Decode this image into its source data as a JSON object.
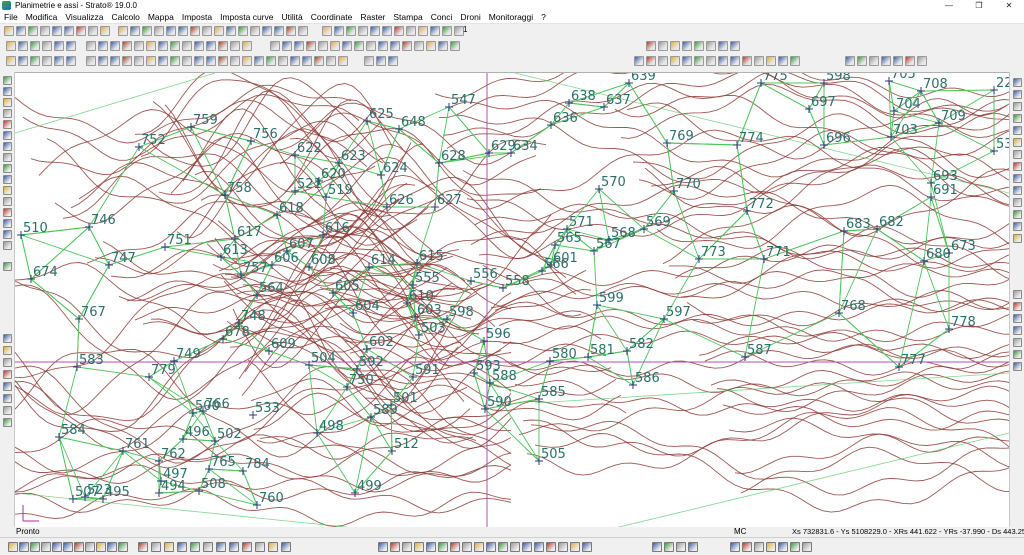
{
  "window": {
    "title": "Planimetrie e assi - Strato® 19.0.0",
    "controls": {
      "minimize": "—",
      "maximize": "❐",
      "close": "✕"
    }
  },
  "menu": [
    "File",
    "Modifica",
    "Visualizza",
    "Calcolo",
    "Mappa",
    "Imposta",
    "Imposta curve",
    "Utilità",
    "Coordinate",
    "Raster",
    "Stampa",
    "Conci",
    "Droni",
    "Monitoraggi",
    "?"
  ],
  "toolbar": {
    "zoom_digit": "1",
    "icon_colors": {
      "primary": "#3a5fa8",
      "green": "#3c9a3c",
      "red": "#c0392b",
      "yellow": "#e0b030",
      "neutral": "#9a9a9a",
      "magenta": "#b0308f"
    }
  },
  "map": {
    "background": "#ffffff",
    "contour_color": "#8c3a34",
    "triangulation_color": "#4bc45a",
    "axis_color": "#b84db8",
    "label_color": "#2b6f6a",
    "marker_color": "#2b3a7a",
    "point_labels": [
      "639",
      "775",
      "598",
      "705",
      "708",
      "22",
      "638",
      "637",
      "697",
      "704",
      "759",
      "756",
      "752",
      "625",
      "648",
      "636",
      "547",
      "769",
      "774",
      "696",
      "703",
      "709",
      "533",
      "622",
      "623",
      "620",
      "629",
      "634",
      "628",
      "624",
      "521",
      "519",
      "570",
      "770",
      "693",
      "691",
      "758",
      "618",
      "626",
      "627",
      "571",
      "569",
      "772",
      "683",
      "682",
      "746",
      "510",
      "751",
      "617",
      "613",
      "607",
      "616",
      "565",
      "567",
      "568",
      "773",
      "771",
      "680",
      "673",
      "674",
      "747",
      "757",
      "606",
      "608",
      "614",
      "615",
      "555",
      "556",
      "558",
      "601",
      "566",
      "564",
      "605",
      "610",
      "599",
      "767",
      "748",
      "604",
      "609",
      "603",
      "598",
      "597",
      "768",
      "778",
      "678",
      "503",
      "596",
      "580",
      "581",
      "582",
      "583",
      "749",
      "504",
      "602",
      "592",
      "593",
      "587",
      "777",
      "779",
      "750",
      "591",
      "588",
      "586",
      "766",
      "500",
      "501",
      "589",
      "590",
      "585",
      "584",
      "784",
      "496",
      "502",
      "498",
      "761",
      "512",
      "762",
      "505",
      "765",
      "497",
      "507",
      "494",
      "508",
      "499",
      "760",
      "495",
      "523",
      "533"
    ]
  },
  "status": {
    "ready": "Pronto",
    "mode": "MC",
    "coords": "Xs 732831.6 - Ys 5108229.0 - XRs 441.622 - YRs -37.990 - Ds 443.25"
  }
}
